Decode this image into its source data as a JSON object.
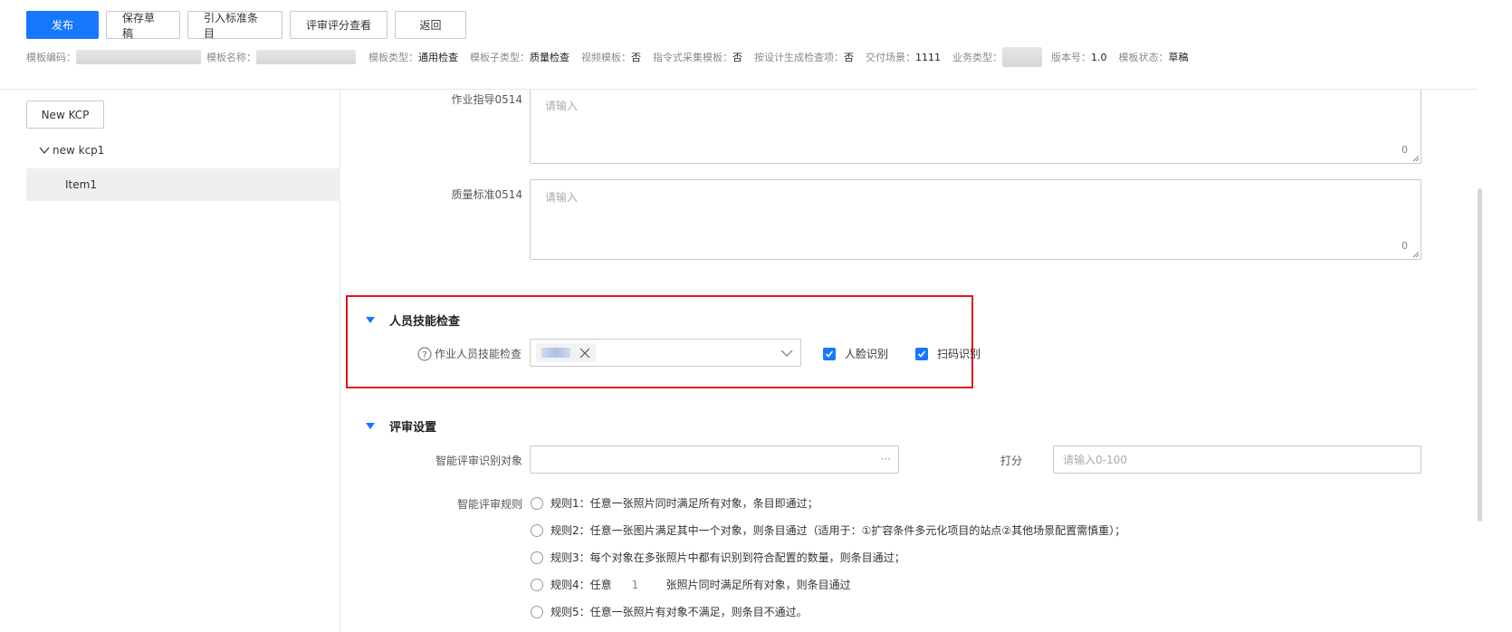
{
  "toolbar": {
    "publish": "发布",
    "save_draft": "保存草稿",
    "import_standard": "引入标准条目",
    "review_score": "评审评分查看",
    "back": "返回"
  },
  "meta": {
    "template_code_label": "模板编码：",
    "template_name_label": "模板名称：",
    "template_type_label": "模板类型：",
    "template_type_value": "通用检查",
    "template_subtype_label": "模板子类型：",
    "template_subtype_value": "质量检查",
    "video_template_label": "视频模板：",
    "video_template_value": "否",
    "command_collect_label": "指令式采集模板：",
    "command_collect_value": "否",
    "design_gen_label": "按设计生成检查项：",
    "design_gen_value": "否",
    "delivery_scene_label": "交付场景：",
    "delivery_scene_value": "1111",
    "business_type_label": "业务类型：",
    "version_label": "版本号：",
    "version_value": "1.0",
    "status_label": "模板状态：",
    "status_value": "草稿"
  },
  "left": {
    "new_kcp": "New KCP",
    "tree_node": "new kcp1",
    "tree_item": "Item1"
  },
  "form": {
    "work_guide_label": "作业指导0514",
    "work_guide_placeholder": "请输入",
    "work_guide_count": "0",
    "quality_std_label": "质量标准0514",
    "quality_std_placeholder": "请输入",
    "quality_std_count": "0"
  },
  "skill": {
    "title": "人员技能检查",
    "field_label": "作业人员技能检查",
    "face_label": "人脸识别",
    "scan_label": "扫码识别"
  },
  "review": {
    "title": "评审设置",
    "target_label": "智能评审识别对象",
    "target_more": "···",
    "score_label": "打分",
    "score_placeholder": "请输入0-100",
    "rules_label": "智能评审规则",
    "rule1": "规则1：任意一张照片同时满足所有对象，条目即通过；",
    "rule2": "规则2：任意一张图片满足其中一个对象，则条目通过（适用于：①扩容条件多元化项目的站点②其他场景配置需慎重）；",
    "rule3": "规则3：每个对象在多张照片中都有识别到符合配置的数量，则条目通过；",
    "rule4_prefix": "规则4：任意",
    "rule4_value": "1",
    "rule4_suffix": "张照片同时满足所有对象，则条目通过",
    "rule5": "规则5：任意一张照片有对象不满足，则条目不通过。"
  },
  "colors": {
    "primary": "#1677ff",
    "highlight_border": "#e5141b"
  }
}
